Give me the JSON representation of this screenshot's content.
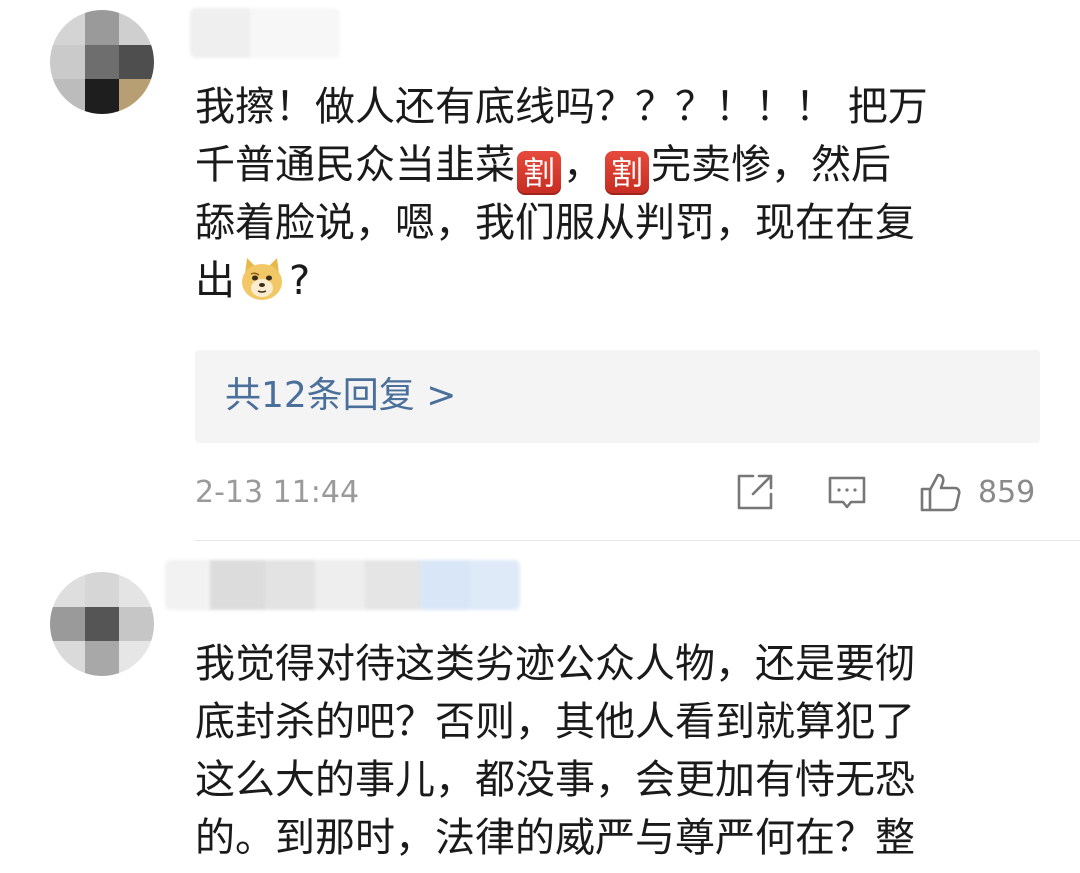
{
  "comments": [
    {
      "lines": [
        "我擦！做人还有底线吗？？？！！！ 把万",
        [
          "千普通民众当韭菜",
          "[cut]",
          "，",
          "[cut]",
          "完卖惨，然后"
        ],
        "舔着脸说，嗯，我们服从判罚，现在在复",
        [
          "出",
          "[doge]",
          "?"
        ]
      ],
      "replies_label": "共12条回复 >",
      "timestamp": "2-13 11:44",
      "likes": "859"
    },
    {
      "lines": [
        "我觉得对待这类劣迹公众人物，还是要彻",
        "底封杀的吧？否则，其他人看到就算犯了",
        "这么大的事儿，都没事，会更加有恃无恐",
        "的。到那时，法律的威严与尊严何在？整"
      ]
    }
  ],
  "emoji": {
    "cut": "割",
    "doge": "doge-emoji"
  },
  "colors": {
    "reply_link": "#4a6f9a",
    "reply_bg": "#f4f4f4",
    "meta_text": "#9a9a9a"
  }
}
